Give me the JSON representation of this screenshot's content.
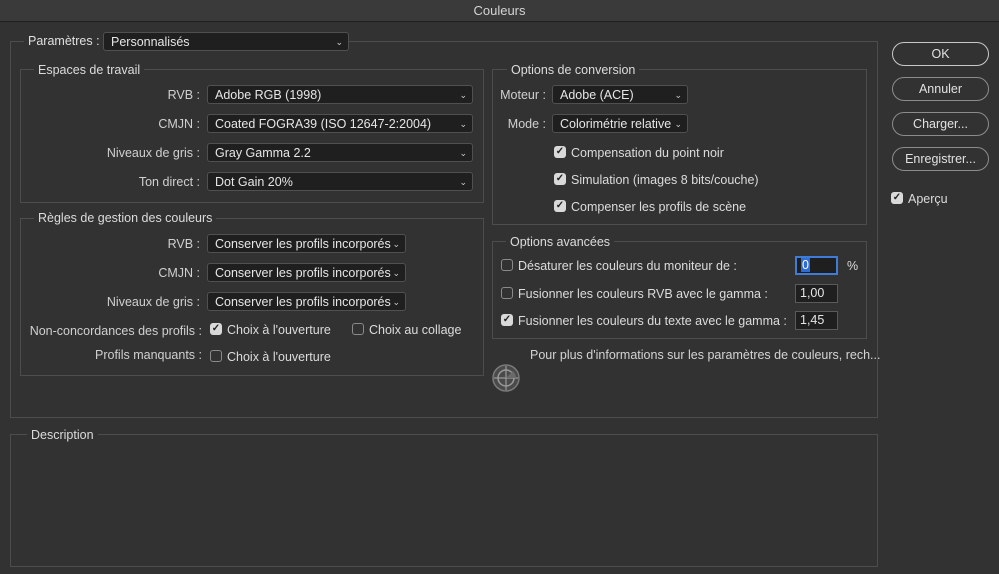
{
  "window": {
    "title": "Couleurs"
  },
  "settings": {
    "label": "Paramètres :",
    "value": "Personnalisés"
  },
  "working_spaces": {
    "title": "Espaces de travail",
    "rows": [
      {
        "label": "RVB :",
        "value": "Adobe RGB (1998)"
      },
      {
        "label": "CMJN :",
        "value": "Coated FOGRA39 (ISO 12647-2:2004)"
      },
      {
        "label": "Niveaux de gris :",
        "value": "Gray Gamma 2.2"
      },
      {
        "label": "Ton direct :",
        "value": "Dot Gain 20%"
      }
    ]
  },
  "color_management": {
    "title": "Règles de gestion des couleurs",
    "rows": [
      {
        "label": "RVB :",
        "value": "Conserver les profils incorporés"
      },
      {
        "label": "CMJN :",
        "value": "Conserver les profils incorporés"
      },
      {
        "label": "Niveaux de gris :",
        "value": "Conserver les profils incorporés"
      }
    ],
    "mismatch_label": "Non-concordances des profils :",
    "ask_open": {
      "label": "Choix à l'ouverture",
      "checked": true
    },
    "ask_paste": {
      "label": "Choix au collage",
      "checked": false
    },
    "missing_label": "Profils manquants :",
    "missing_ask_open": {
      "label": "Choix à l'ouverture",
      "checked": false
    }
  },
  "conversion": {
    "title": "Options de conversion",
    "engine_label": "Moteur :",
    "engine_value": "Adobe (ACE)",
    "intent_label": "Mode :",
    "intent_value": "Colorimétrie relative",
    "checks": [
      {
        "label": "Compensation du point noir",
        "checked": true
      },
      {
        "label": "Simulation (images 8 bits/couche)",
        "checked": true
      },
      {
        "label": "Compenser les profils de scène",
        "checked": true
      }
    ]
  },
  "advanced": {
    "title": "Options avancées",
    "rows": [
      {
        "label": "Désaturer les couleurs du moniteur de :",
        "checked": false,
        "value": "0",
        "unit": "%"
      },
      {
        "label": "Fusionner les couleurs RVB avec le gamma :",
        "checked": false,
        "value": "1,00",
        "unit": ""
      },
      {
        "label": "Fusionner les couleurs du texte avec le gamma :",
        "checked": true,
        "value": "1,45",
        "unit": ""
      }
    ]
  },
  "info_text": "Pour plus d'informations sur les paramètres de couleurs, rech...",
  "description": {
    "title": "Description"
  },
  "buttons": {
    "ok": "OK",
    "cancel": "Annuler",
    "load": "Charger...",
    "save": "Enregistrer..."
  },
  "preview": {
    "label": "Aperçu",
    "checked": true
  },
  "icons": {
    "checkmark": "check-icon",
    "chevron": "chevron-down-icon",
    "sync": "color-sync-icon"
  }
}
